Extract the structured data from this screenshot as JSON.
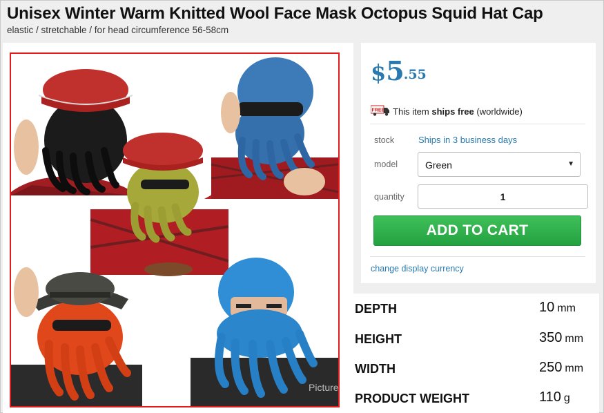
{
  "product": {
    "title": "Unisex Winter Warm Knitted Wool Face Mask Octopus Squid Hat Cap",
    "subtitle": "elastic / stretchable / for head circumference 56-58cm",
    "image_watermark": "Picture"
  },
  "price": {
    "currency": "$",
    "whole": "5",
    "cents": ".55",
    "color": "#2a7ab0"
  },
  "shipping": {
    "badge": "FREE",
    "text_before": "This item ",
    "bold": "ships free",
    "text_after": " (worldwide)"
  },
  "stock": {
    "label": "stock",
    "value": "Ships in 3 business days"
  },
  "model": {
    "label": "model",
    "selected": "Green"
  },
  "quantity": {
    "label": "quantity",
    "value": "1"
  },
  "cart": {
    "button_label": "ADD TO CART",
    "button_color": "#2aa845"
  },
  "links": {
    "change_currency": "change display currency"
  },
  "specs": [
    {
      "name": "DEPTH",
      "value": "10",
      "unit": "mm"
    },
    {
      "name": "HEIGHT",
      "value": "350",
      "unit": "mm"
    },
    {
      "name": "WIDTH",
      "value": "250",
      "unit": "mm"
    },
    {
      "name": "PRODUCT WEIGHT",
      "value": "110",
      "unit": "g"
    }
  ]
}
